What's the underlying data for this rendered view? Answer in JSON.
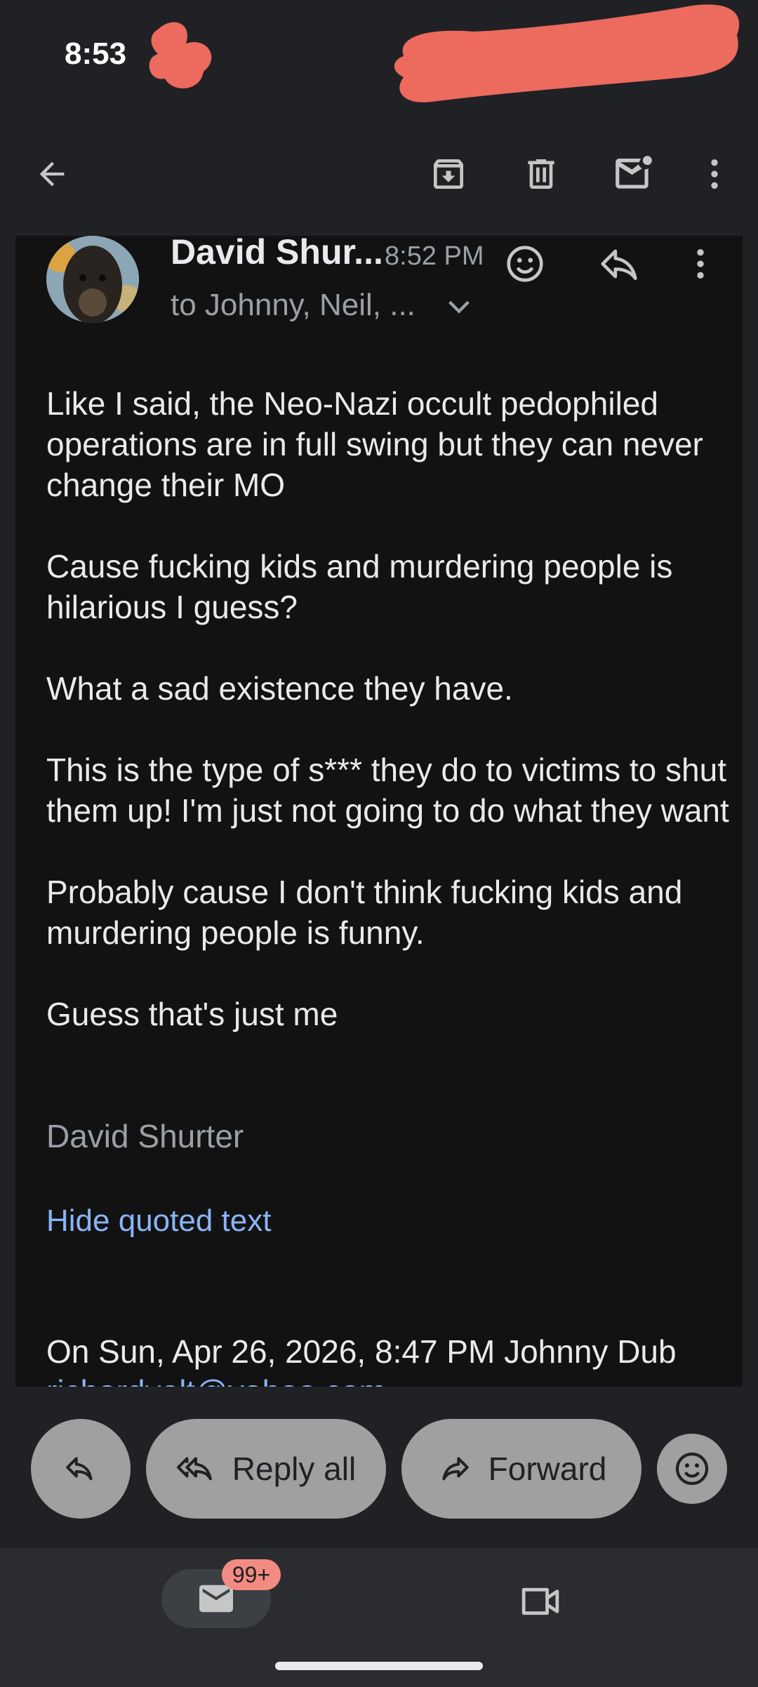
{
  "status": {
    "time": "8:53"
  },
  "message": {
    "sender": "David Shur...",
    "time": "8:52 PM",
    "recipients": "to Johnny, Neil, ...",
    "body": [
      "Like I said, the Neo-Nazi occult pedophiled operations are in full swing but they can never change their MO",
      "Cause fucking kids and murdering people is hilarious I guess?",
      "What a sad existence they have.",
      "This is the type of s*** they do to victims to shut them up! I'm just not going to do what they want",
      "Probably cause I don't think fucking kids and murdering people is funny.",
      "Guess that's just me"
    ],
    "signature": "David Shurter",
    "hide_quoted": "Hide quoted text",
    "quote_header": "On Sun, Apr 26, 2026, 8:47 PM Johnny Dub",
    "quote_email_partial": "richardvolt@yahoo.com"
  },
  "actions": {
    "reply_all": "Reply all",
    "forward": "Forward"
  },
  "nav": {
    "mail_badge": "99+"
  },
  "icons": [
    "back-arrow-icon",
    "archive-icon",
    "trash-icon",
    "mark-unread-icon",
    "more-vert-icon",
    "emoji-icon",
    "reply-icon",
    "reply-all-icon",
    "forward-icon",
    "mail-icon",
    "video-icon",
    "chevron-down-icon"
  ],
  "colors": {
    "background": "#202124",
    "card": "#121212",
    "link": "#8ab4f8",
    "pill": "#a0a0a0",
    "badge": "#f28b82",
    "redaction": "#ec6a5e"
  }
}
